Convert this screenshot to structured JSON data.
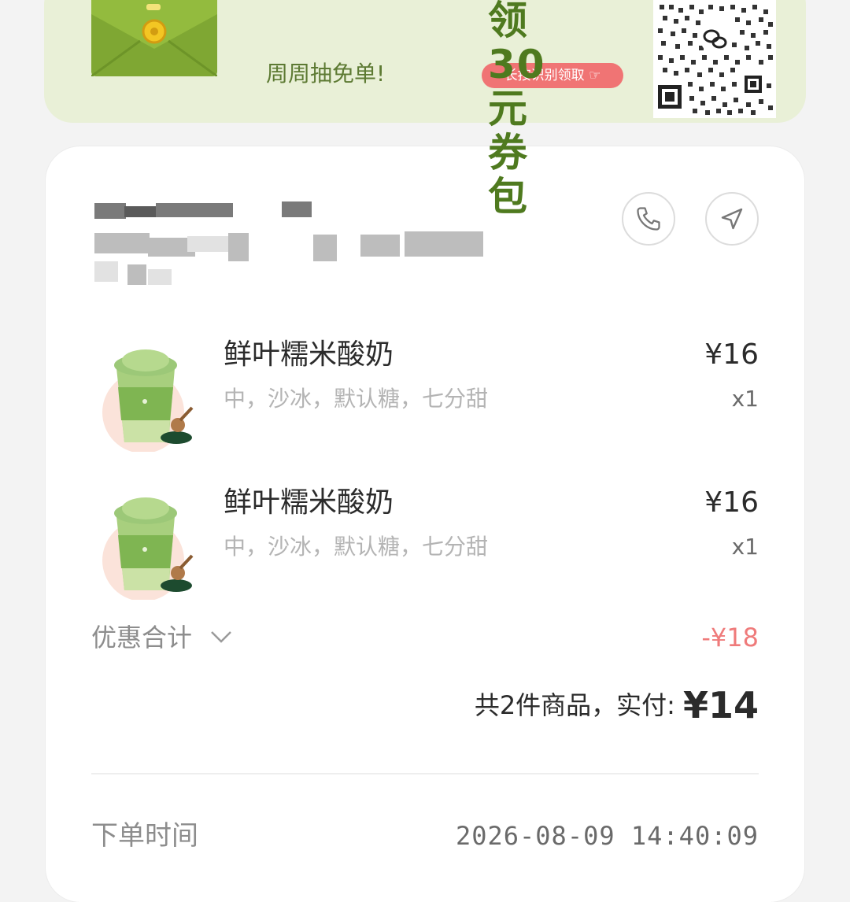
{
  "banner": {
    "title": "领30元券包",
    "subtitle": "周周抽免单!",
    "pill_text": "长按识别领取",
    "qr_icon": "qr-code-icon",
    "envelope_icon": "red-envelope-icon",
    "accent_color": "#4f7a1f",
    "pill_color": "#f07474"
  },
  "store": {
    "phone_icon": "phone-icon",
    "navigate_icon": "navigation-arrow-icon"
  },
  "items": [
    {
      "name": "鲜叶糯米酸奶",
      "spec": "中，沙冰，默认糖，七分甜",
      "price": "¥16",
      "qty": "x1"
    },
    {
      "name": "鲜叶糯米酸奶",
      "spec": "中，沙冰，默认糖，七分甜",
      "price": "¥16",
      "qty": "x1"
    }
  ],
  "discount": {
    "label": "优惠合计",
    "value": "-¥18",
    "color": "#ef7b7b"
  },
  "total": {
    "label": "共2件商品，实付:",
    "value": "¥14"
  },
  "order": {
    "time_label": "下单时间",
    "time_value": "2026-08-09 14:40:09"
  }
}
